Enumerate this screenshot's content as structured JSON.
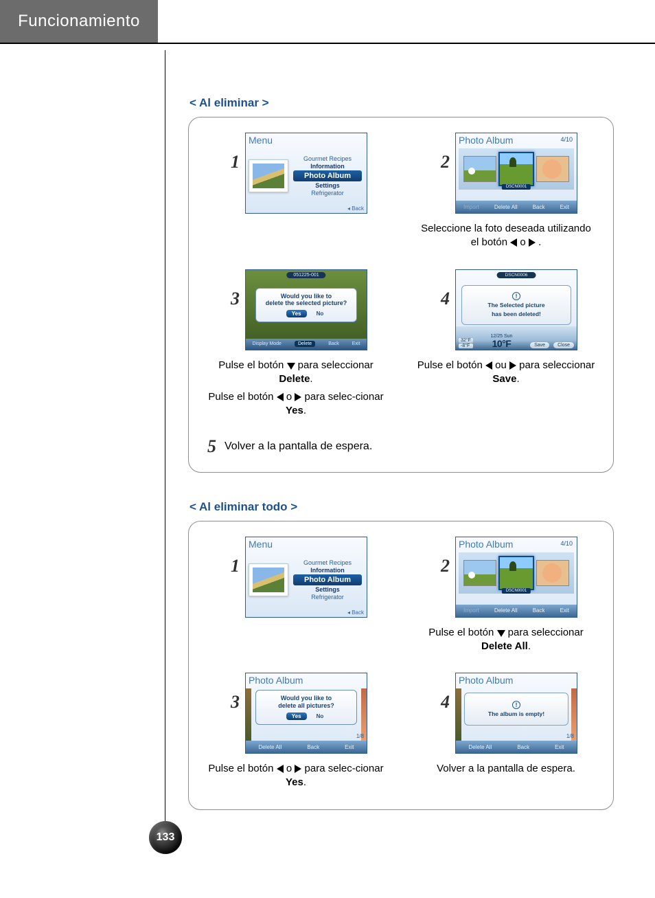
{
  "page": {
    "header": "Funcionamiento",
    "number": "133"
  },
  "sec1": {
    "title": "< Al eliminar >",
    "s1": {
      "num": "1"
    },
    "s2": {
      "num": "2",
      "cap_a": "Seleccione la foto deseada utilizando el botón ",
      "cap_b": " o ",
      "cap_c": " ."
    },
    "s3": {
      "num": "3",
      "cap1_a": "Pulse el botón ",
      "cap1_b": " para seleccionar ",
      "cap1_bold": "Delete",
      "cap1_c": ".",
      "cap2_a": "Pulse el botón ",
      "cap2_b": " o ",
      "cap2_c": " para selec-cionar ",
      "cap2_bold": "Yes",
      "cap2_d": "."
    },
    "s4": {
      "num": "4",
      "cap_a": "Pulse el botón ",
      "cap_b": " ou ",
      "cap_c": " para seleccionar ",
      "cap_bold": "Save",
      "cap_d": "."
    },
    "s5": {
      "num": "5",
      "text": "Volver a la pantalla de espera."
    }
  },
  "sec2": {
    "title": "< Al eliminar todo >",
    "s1": {
      "num": "1"
    },
    "s2": {
      "num": "2",
      "cap_a": "Pulse el botón ",
      "cap_b": " para seleccionar ",
      "cap_bold": "Delete All",
      "cap_c": "."
    },
    "s3": {
      "num": "3",
      "cap_a": "Pulse el botón ",
      "cap_b": " o ",
      "cap_c": " para selec-cionar ",
      "cap_bold": "Yes",
      "cap_d": "."
    },
    "s4": {
      "num": "4",
      "text": "Volver a la pantalla de espera."
    }
  },
  "lcd": {
    "menu": {
      "title": "Menu",
      "i1": "Gourmet Recipes",
      "i2": "Information",
      "hl": "Photo Album",
      "i3": "Settings",
      "i4": "Refrigerator",
      "back": "◂ Back"
    },
    "album": {
      "title": "Photo Album",
      "count": "4/10",
      "tag": "DSCN0001",
      "b1": "Import",
      "b2": "Delete All",
      "b3": "Back",
      "b4": "Exit"
    },
    "confirm1": {
      "tag": "051225-001",
      "q1": "Would you like to",
      "q2": "delete the selected picture?",
      "yes": "Yes",
      "no": "No",
      "f1": "Display Mode",
      "f2": "Delete",
      "f3": "Back",
      "f4": "Exit"
    },
    "deleted": {
      "tag": "DSCN0006",
      "m1": "The Selected picture",
      "m2": "has been deleted!",
      "t1": "32°F",
      "t2": "-8°F",
      "date": "12/25 Sun",
      "big": "10°F",
      "save": "Save",
      "close": "Close"
    },
    "confirm2": {
      "title": "Photo Album",
      "q1": "Would you like to",
      "q2": "delete all pictures?",
      "yes": "Yes",
      "no": "No",
      "corner": "1/8",
      "b1": "Delete All",
      "b2": "Back",
      "b3": "Exit"
    },
    "empty": {
      "title": "Photo Album",
      "msg": "The album is empty!",
      "corner": "1/8",
      "b1": "Delete All",
      "b2": "Back",
      "b3": "Exit"
    }
  }
}
